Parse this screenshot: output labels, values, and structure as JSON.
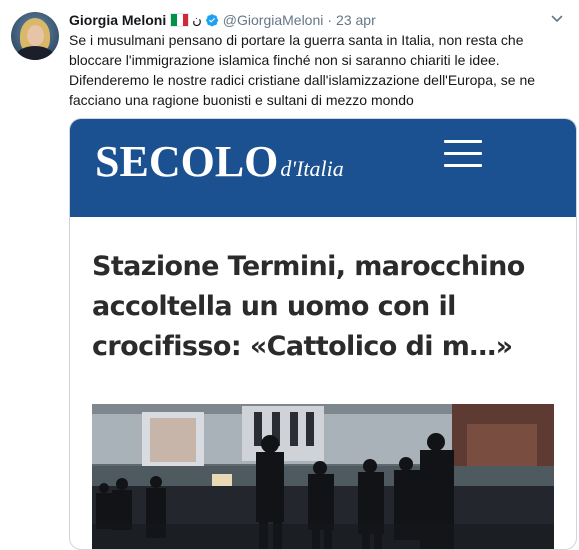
{
  "tweet": {
    "author_name": "Giorgia Meloni",
    "flag_icon": "italy-flag-icon",
    "flag_colors": [
      "#009246",
      "#ffffff",
      "#ce2b37"
    ],
    "name_symbol": "ن",
    "verified_icon": "verified-badge-icon",
    "verified_color": "#1da1f2",
    "handle": "@GiorgiaMeloni",
    "separator": "·",
    "time": "23 apr",
    "text": "Se i musulmani pensano di portare la guerra santa in Italia, non resta che bloccare l'immigrazione islamica finché non si saranno chiariti le idee. Difenderemo le nostre radici cristiane dall'islamizzazione dell'Europa, se ne facciano una ragione buonisti e sultani di mezzo mondo"
  },
  "card": {
    "site_logo_main": "SECOLO",
    "site_logo_sub": "d'Italia",
    "header_color": "#1b5091",
    "menu_icon": "hamburger-menu-icon",
    "article_title": "Stazione Termini, marocchino accoltella un uomo con il crocifisso: «Cattolico di m…»",
    "photo_icon": "station-police-photo"
  }
}
